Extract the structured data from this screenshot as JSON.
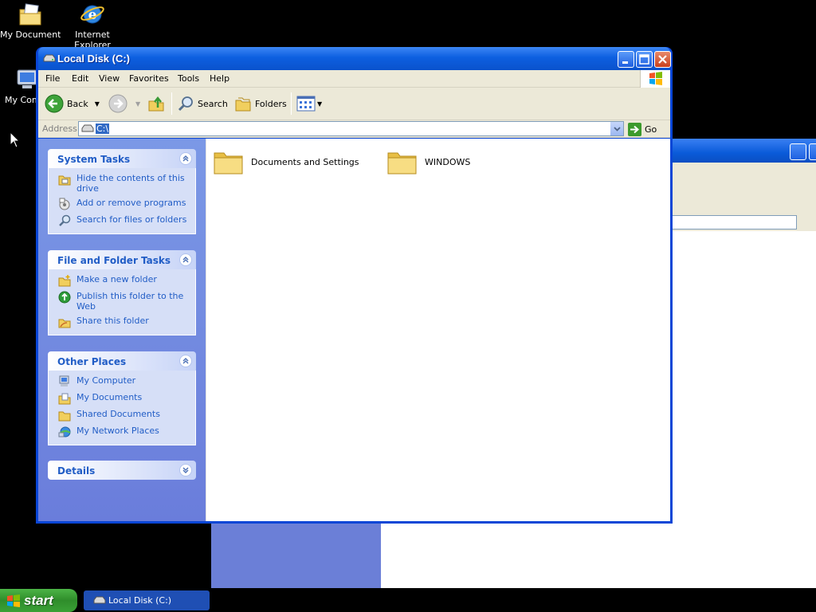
{
  "desktop": {
    "icons": [
      {
        "label": "My Documents"
      },
      {
        "label": "Internet Explorer"
      },
      {
        "label": "My Computer"
      }
    ]
  },
  "window": {
    "title": "Local Disk (C:)",
    "menu": [
      "File",
      "Edit",
      "View",
      "Favorites",
      "Tools",
      "Help"
    ],
    "toolbar": {
      "back_label": "Back",
      "search_label": "Search",
      "folders_label": "Folders"
    },
    "address": {
      "label": "Address",
      "value": "C:\\",
      "go_label": "Go"
    },
    "taskpane": {
      "system_tasks": {
        "title": "System Tasks",
        "items": [
          "Hide the contents of this drive",
          "Add or remove programs",
          "Search for files or folders"
        ]
      },
      "file_folder_tasks": {
        "title": "File and Folder Tasks",
        "items": [
          "Make a new folder",
          "Publish this folder to the Web",
          "Share this folder"
        ]
      },
      "other_places": {
        "title": "Other Places",
        "items": [
          "My Computer",
          "My Documents",
          "Shared Documents",
          "My Network Places"
        ]
      },
      "details": {
        "title": "Details"
      }
    },
    "content": {
      "folders": [
        "Documents and Settings",
        "WINDOWS"
      ]
    }
  },
  "taskbar": {
    "start_label": "start",
    "tasks": [
      {
        "label": "Local Disk (C:)"
      }
    ]
  },
  "colors": {
    "title_blue": "#0a52cc",
    "link_blue": "#215dc6",
    "taskpane_bg": "#7b98e6",
    "start_green": "#3aa136"
  }
}
